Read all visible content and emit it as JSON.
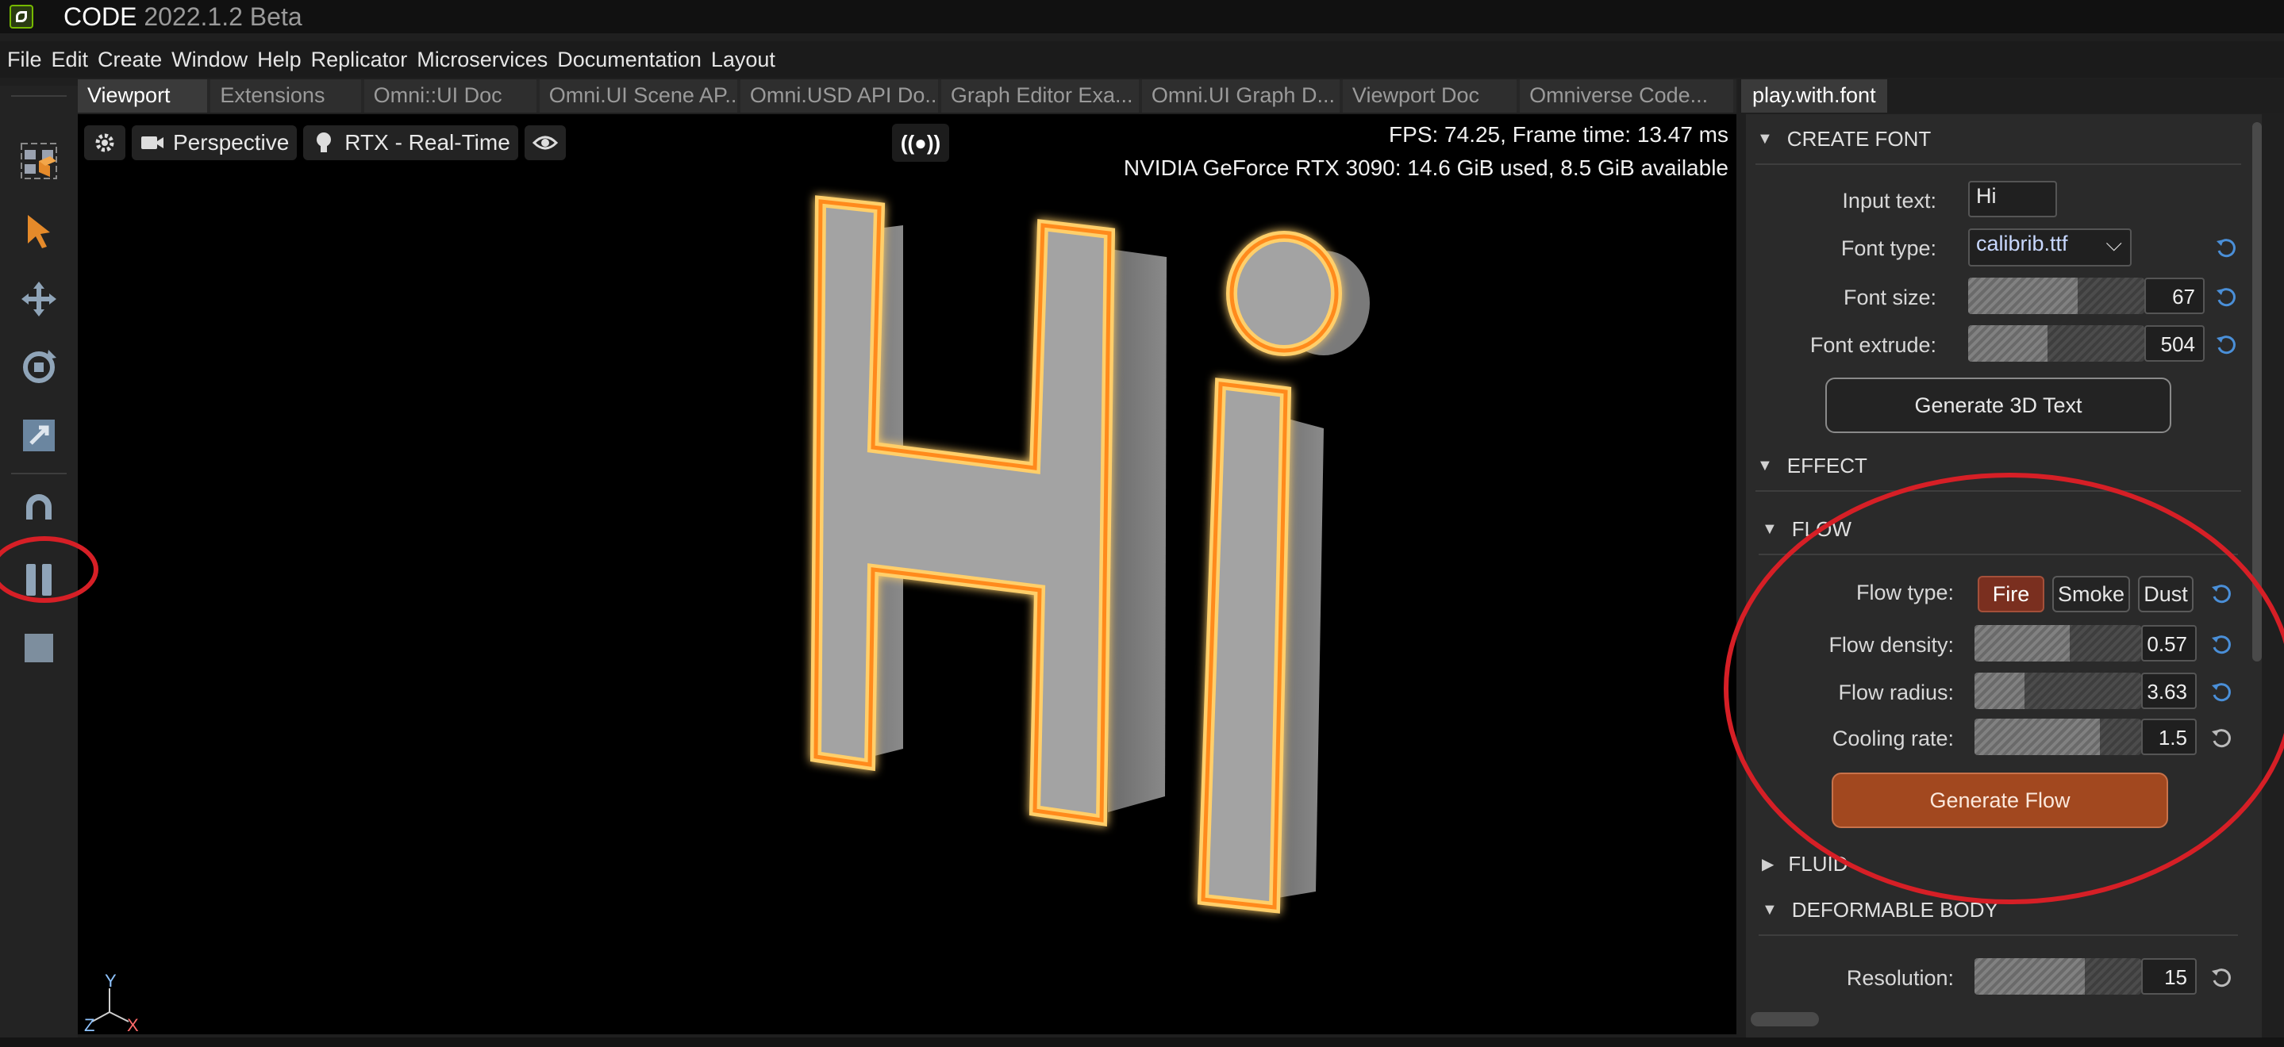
{
  "app": {
    "name": "CODE",
    "version": "2022.1.2 Beta"
  },
  "menu": [
    "File",
    "Edit",
    "Create",
    "Window",
    "Help",
    "Replicator",
    "Microservices",
    "Documentation",
    "Layout"
  ],
  "toolbar_icons": [
    "select-mode-icon",
    "pointer-icon",
    "move-icon",
    "rotate-icon",
    "scale-icon",
    "snap-magnet-icon",
    "pause-icon",
    "stop-icon"
  ],
  "viewport_tabs": [
    "Viewport",
    "Extensions",
    "Omni::UI Doc",
    "Omni.UI Scene AP...",
    "Omni.USD API Do...",
    "Graph Editor Exa...",
    "Omni.UI Graph D...",
    "Viewport Doc",
    "Omniverse Code..."
  ],
  "viewport": {
    "camera_label": "Perspective",
    "renderer_label": "RTX - Real-Time",
    "live_label": "((●))",
    "fps_text": "FPS: 74.25, Frame time: 13.47 ms",
    "gpu_text": "NVIDIA GeForce RTX 3090: 14.6 GiB used,  8.5 GiB available",
    "axis_y": "Y",
    "axis_z": "Z",
    "axis_x": "X",
    "scene_text": "Hi"
  },
  "panel": {
    "tab_label": "play.with.font",
    "create_font": {
      "header": "CREATE FONT",
      "input_text_label": "Input text:",
      "input_text_value": "Hi",
      "font_type_label": "Font type:",
      "font_type_value": "calibrib.ttf",
      "font_size_label": "Font size:",
      "font_size_value": "67",
      "font_size_fill": 0.62,
      "font_extrude_label": "Font extrude:",
      "font_extrude_value": "504",
      "font_extrude_fill": 0.45,
      "generate_label": "Generate 3D Text"
    },
    "effect_header": "EFFECT",
    "flow": {
      "header": "FLOW",
      "flow_type_label": "Flow type:",
      "types": [
        "Fire",
        "Smoke",
        "Dust"
      ],
      "active_type": "Fire",
      "density_label": "Flow density:",
      "density_value": "0.57",
      "density_fill": 0.57,
      "radius_label": "Flow radius:",
      "radius_value": "3.63",
      "radius_fill": 0.3,
      "cooling_label": "Cooling rate:",
      "cooling_value": "1.5",
      "cooling_fill": 0.75,
      "generate_label": "Generate Flow"
    },
    "fluid_header": "FLUID",
    "deformable": {
      "header": "DEFORMABLE BODY",
      "resolution_label": "Resolution:",
      "resolution_value": "15",
      "resolution_fill": 0.66
    }
  },
  "colors": {
    "accent_orange": "#a2481f",
    "fire_active": "#7a2f1f",
    "reset_blue": "#4a8fd8",
    "annotation_red": "#d61f26",
    "nvidia_green": "#76b900"
  }
}
